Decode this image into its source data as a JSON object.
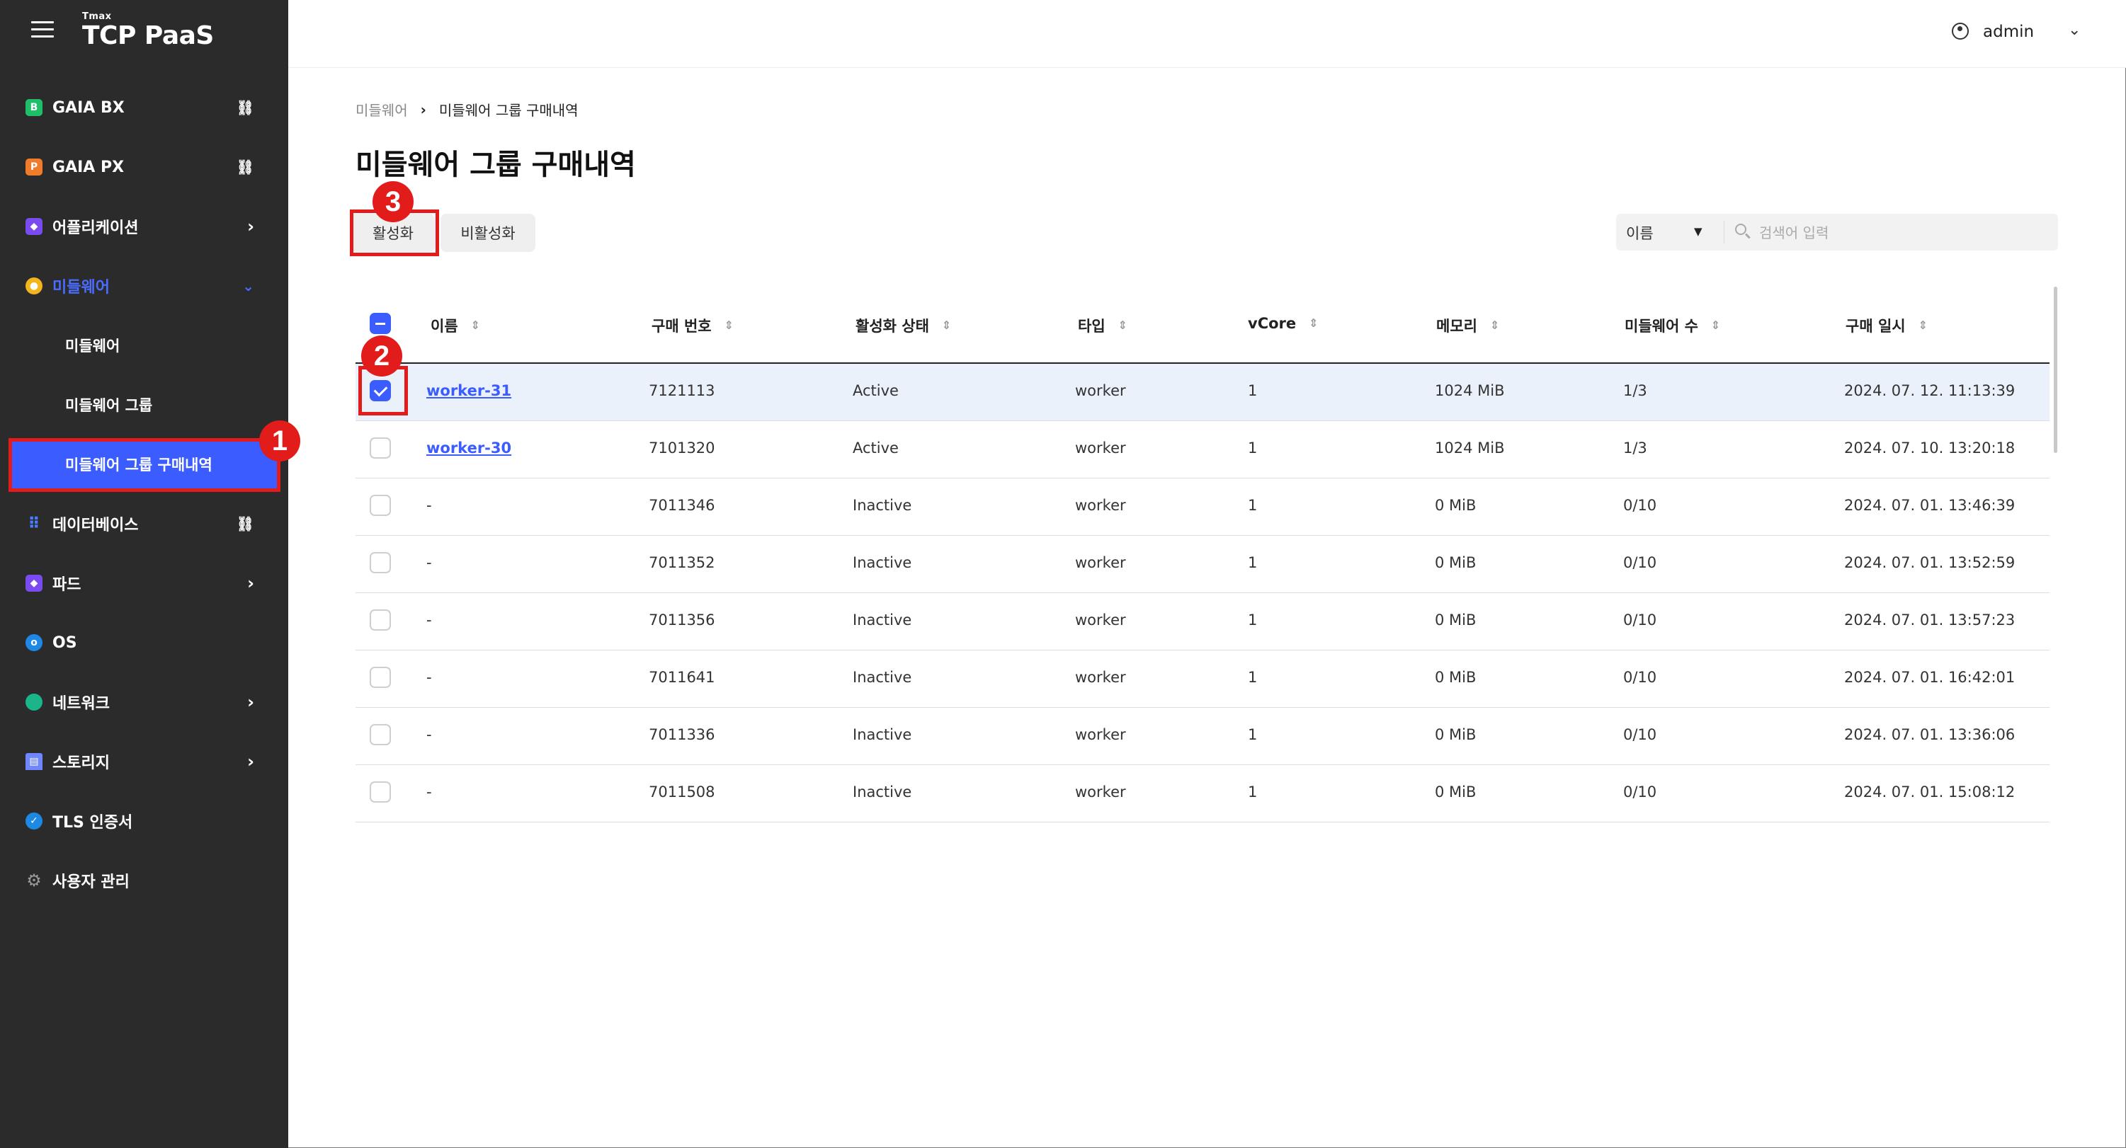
{
  "app": {
    "brand_small": "Tmax",
    "brand_name": "TCP PaaS"
  },
  "header": {
    "user_name": "admin"
  },
  "sidebar": {
    "items": [
      {
        "label": "GAIA BX",
        "icon": "gaia-bx-icon",
        "right": "link"
      },
      {
        "label": "GAIA PX",
        "icon": "gaia-px-icon",
        "right": "link"
      },
      {
        "label": "어플리케이션",
        "icon": "cube-icon",
        "right": "chevron"
      },
      {
        "label": "미들웨어",
        "icon": "middleware-icon",
        "right": "chevron-down"
      },
      {
        "label": "데이터베이스",
        "icon": "grid-icon",
        "right": "link"
      },
      {
        "label": "파드",
        "icon": "cube-icon",
        "right": "chevron"
      },
      {
        "label": "OS",
        "icon": "os-icon",
        "right": ""
      },
      {
        "label": "네트워크",
        "icon": "globe-icon",
        "right": "chevron"
      },
      {
        "label": "스토리지",
        "icon": "storage-icon",
        "right": "chevron"
      },
      {
        "label": "TLS 인증서",
        "icon": "shield-icon",
        "right": ""
      },
      {
        "label": "사용자 관리",
        "icon": "gear-icon",
        "right": ""
      }
    ],
    "subitems": [
      {
        "label": "미들웨어"
      },
      {
        "label": "미들웨어 그룹"
      },
      {
        "label": "미들웨어 그룹 구매내역"
      }
    ]
  },
  "annotations": {
    "m1": "1",
    "m2": "2",
    "m3": "3"
  },
  "breadcrumb": {
    "parent": "미들웨어",
    "separator": "›",
    "current": "미들웨어 그룹 구매내역"
  },
  "page": {
    "title": "미들웨어 그룹 구매내역"
  },
  "toolbar": {
    "activate_label": "활성화",
    "deactivate_label": "비활성화"
  },
  "search": {
    "filter_value": "이름",
    "placeholder": "검색어 입력"
  },
  "table": {
    "columns": [
      "이름",
      "구매 번호",
      "활성화 상태",
      "타입",
      "vCore",
      "메모리",
      "미들웨어 수",
      "구매 일시"
    ],
    "rows": [
      {
        "name": "worker-31",
        "purchase_no": "7121113",
        "status": "Active",
        "type": "worker",
        "vcore": "1",
        "memory": "1024 MiB",
        "count": "1/3",
        "date": "2024. 07. 12. 11:13:39",
        "checked": true
      },
      {
        "name": "worker-30",
        "purchase_no": "7101320",
        "status": "Active",
        "type": "worker",
        "vcore": "1",
        "memory": "1024 MiB",
        "count": "1/3",
        "date": "2024. 07. 10. 13:20:18",
        "checked": false
      },
      {
        "name": "-",
        "purchase_no": "7011346",
        "status": "Inactive",
        "type": "worker",
        "vcore": "1",
        "memory": "0 MiB",
        "count": "0/10",
        "date": "2024. 07. 01. 13:46:39",
        "checked": false
      },
      {
        "name": "-",
        "purchase_no": "7011352",
        "status": "Inactive",
        "type": "worker",
        "vcore": "1",
        "memory": "0 MiB",
        "count": "0/10",
        "date": "2024. 07. 01. 13:52:59",
        "checked": false
      },
      {
        "name": "-",
        "purchase_no": "7011356",
        "status": "Inactive",
        "type": "worker",
        "vcore": "1",
        "memory": "0 MiB",
        "count": "0/10",
        "date": "2024. 07. 01. 13:57:23",
        "checked": false
      },
      {
        "name": "-",
        "purchase_no": "7011641",
        "status": "Inactive",
        "type": "worker",
        "vcore": "1",
        "memory": "0 MiB",
        "count": "0/10",
        "date": "2024. 07. 01. 16:42:01",
        "checked": false
      },
      {
        "name": "-",
        "purchase_no": "7011336",
        "status": "Inactive",
        "type": "worker",
        "vcore": "1",
        "memory": "0 MiB",
        "count": "0/10",
        "date": "2024. 07. 01. 13:36:06",
        "checked": false
      },
      {
        "name": "-",
        "purchase_no": "7011508",
        "status": "Inactive",
        "type": "worker",
        "vcore": "1",
        "memory": "0 MiB",
        "count": "0/10",
        "date": "2024. 07. 01. 15:08:12",
        "checked": false
      }
    ]
  },
  "colors": {
    "accent": "#3b5cff",
    "sidebar_bg": "#2b2b2b",
    "annotation_red": "#e21b1b",
    "selected_row": "#eaf1fb"
  }
}
